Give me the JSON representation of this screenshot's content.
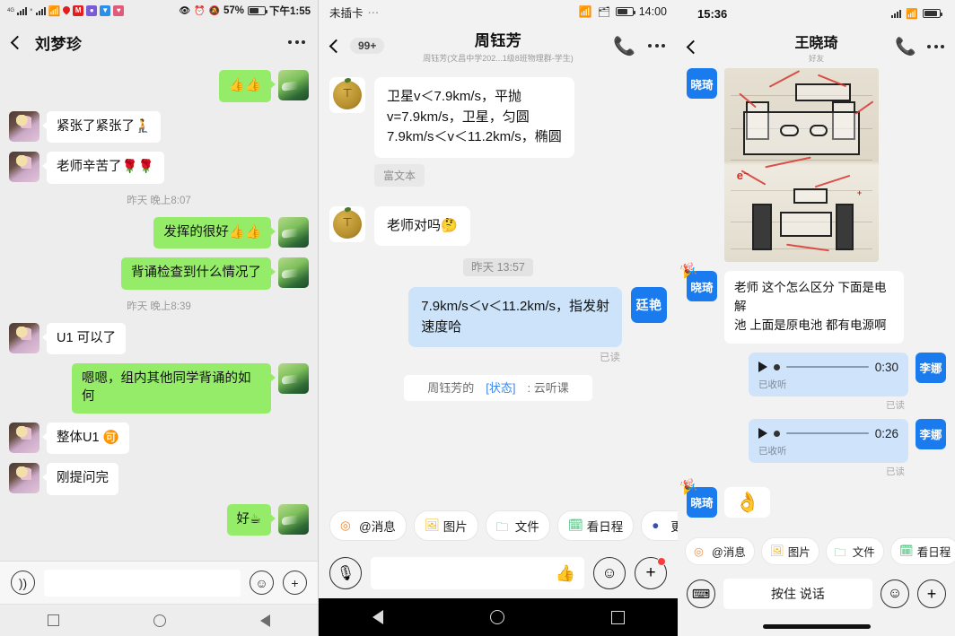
{
  "panel1": {
    "status_bar": {
      "network_label": "4G",
      "battery_percent": "57%",
      "time": "下午1:55",
      "icons": [
        "signal-bars",
        "signal-bars-2",
        "wifi-icon",
        "location-pin-icon",
        "app-icon-red",
        "app-icon-purple",
        "app-icon-blue",
        "app-icon-pink",
        "eye-icon",
        "alarm-icon",
        "mute-icon",
        "battery-icon"
      ]
    },
    "header": {
      "back": "‹",
      "title": "刘梦珍",
      "more": "⋯"
    },
    "messages": [
      {
        "side": "out",
        "type": "text",
        "text": "👍👍"
      },
      {
        "side": "in",
        "type": "text",
        "text": "紧张了紧张了🧎"
      },
      {
        "side": "in",
        "type": "text",
        "text": "老师辛苦了🌹🌹"
      },
      {
        "side": "time",
        "type": "time",
        "text": "昨天 晚上8:07"
      },
      {
        "side": "out",
        "type": "text",
        "text": "发挥的很好👍👍"
      },
      {
        "side": "out",
        "type": "text",
        "text": "背诵检查到什么情况了"
      },
      {
        "side": "time",
        "type": "time",
        "text": "昨天 晚上8:39"
      },
      {
        "side": "in",
        "type": "text",
        "text": "U1 可以了"
      },
      {
        "side": "out",
        "type": "text",
        "text": "嗯嗯，组内其他同学背诵的如何"
      },
      {
        "side": "in",
        "type": "text",
        "text": "整体U1 🉑"
      },
      {
        "side": "in",
        "type": "text",
        "text": "刚提问完"
      },
      {
        "side": "out",
        "type": "text",
        "text": "好☕"
      }
    ],
    "input_bar": {
      "voice_icon": "voice-wave-icon",
      "placeholder": "",
      "emoji_icon": "emoji-icon",
      "plus_icon": "plus-icon"
    },
    "nav_bar": {
      "recents": "square-icon",
      "home": "circle-icon",
      "back": "triangle-back-icon"
    }
  },
  "panel2": {
    "status_bar": {
      "carrier": "未插卡",
      "dots": "⋯",
      "time": "14:00",
      "icons": [
        "wifi-icon",
        "sim-icon",
        "battery-icon"
      ]
    },
    "header": {
      "back": "‹",
      "unread_badge": "99+",
      "title": "周钰芳",
      "subtitle": "周钰芳(文昌中学202...1级8班物理群-学生)",
      "call_icon": "video-call-icon",
      "more": "⋯"
    },
    "messages": [
      {
        "side": "in",
        "type": "text",
        "avatar": "orange-avatar",
        "lines": [
          "卫星v＜7.9km/s，平抛",
          "v=7.9km/s，卫星，匀圆",
          "7.9km/s＜v＜11.2km/s，椭圆"
        ],
        "tag": "富文本"
      },
      {
        "side": "in",
        "type": "text",
        "avatar": "orange-avatar",
        "lines": [
          "老师对吗🤔"
        ]
      },
      {
        "side": "time",
        "type": "time",
        "text": "昨天 13:57"
      },
      {
        "side": "out",
        "type": "text",
        "avatar_name": "廷艳",
        "lines": [
          "7.9km/s＜v＜11.2km/s，指发射",
          "速度哈"
        ],
        "read_mark": "已读"
      }
    ],
    "status_notice": {
      "prefix": "周钰芳的",
      "highlight": "[状态]",
      "suffix": ": 云听课"
    },
    "chips": [
      {
        "label": "@消息",
        "icon": "at-message-icon",
        "color": "#f08c3a"
      },
      {
        "label": "图片",
        "icon": "image-icon",
        "color": "#f3b527"
      },
      {
        "label": "文件",
        "icon": "folder-icon",
        "color": "#3aba6e"
      },
      {
        "label": "看日程",
        "icon": "calendar-icon",
        "color": "#3aba6e"
      },
      {
        "label": "更",
        "icon": "more-icon",
        "color": "#3b4fa8"
      }
    ],
    "input_bar": {
      "mic_icon": "microphone-icon",
      "placeholder": "",
      "thumb_icon": "thumbs-up-icon",
      "emoji_icon": "emoji-icon",
      "plus_icon": "plus-icon-with-badge"
    },
    "nav_bar": {
      "back": "triangle-back-icon",
      "home": "circle-icon",
      "recents": "square-icon"
    }
  },
  "panel3": {
    "status_bar": {
      "time": "15:36",
      "icons": [
        "signal-bars",
        "wifi-icon",
        "battery-icon"
      ]
    },
    "header": {
      "back": "‹",
      "title": "王晓琦",
      "subtitle": "好友",
      "call_icon": "video-call-icon",
      "more": "⋯"
    },
    "messages": [
      {
        "side": "in",
        "type": "photo",
        "avatar_name": "晓琦",
        "description": "handwritten-chemistry-diagram-photo"
      },
      {
        "side": "in",
        "type": "text",
        "avatar_name": "晓琦",
        "lines": [
          "老师 这个怎么区分 下面是电解",
          "池 上面是原电池 都有电源啊"
        ]
      },
      {
        "side": "out",
        "type": "voice",
        "avatar_name": "李娜",
        "duration": "0:30",
        "listened": "已收听",
        "read_mark": "已读"
      },
      {
        "side": "out",
        "type": "voice",
        "avatar_name": "李娜",
        "duration": "0:26",
        "listened": "已收听",
        "read_mark": "已读"
      },
      {
        "side": "in",
        "type": "emoji",
        "avatar_name": "晓琦",
        "emoji": "👌"
      }
    ],
    "chips": [
      {
        "label": "@消息",
        "icon": "at-message-icon",
        "color": "#f08c3a"
      },
      {
        "label": "图片",
        "icon": "image-icon",
        "color": "#f3b527"
      },
      {
        "label": "文件",
        "icon": "folder-icon",
        "color": "#3aba6e"
      },
      {
        "label": "看日程",
        "icon": "calendar-icon",
        "color": "#3aba6e"
      },
      {
        "label": "",
        "icon": "more-icon",
        "color": "#3b4fa8"
      }
    ],
    "input_bar": {
      "keyboard_icon": "keyboard-icon",
      "talk_label": "按住 说话",
      "emoji_icon": "emoji-icon",
      "plus_icon": "plus-icon"
    }
  },
  "colors": {
    "wechat_green": "#95ec69",
    "wecom_blue": "#cce3fa",
    "avatar_blue": "#1a7bee",
    "bg_gray": "#ededed",
    "link_blue": "#3b86e8"
  }
}
